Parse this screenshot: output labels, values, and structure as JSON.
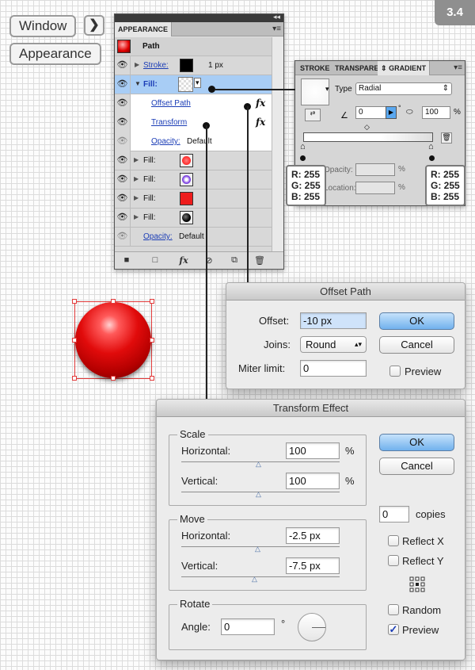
{
  "step_badge": "3.4",
  "menu_path": {
    "window_label": "Window",
    "arrow_icon": "chevron-right-icon",
    "appearance_label": "Appearance"
  },
  "appearance_panel": {
    "tab": "APPEARANCE",
    "object_label": "Path",
    "rows": [
      {
        "label": "Stroke:",
        "value": "1 px",
        "swatch": "#000000"
      },
      {
        "label": "Fill:"
      },
      {
        "label": "Offset Path",
        "fx": "fx"
      },
      {
        "label": "Transform",
        "fx": "fx"
      },
      {
        "label": "Opacity:",
        "value": "Default"
      },
      {
        "label": "Fill:",
        "swatch": "#ff1a1a"
      },
      {
        "label": "Fill:",
        "swatch": "#7b3fe0"
      },
      {
        "label": "Fill:",
        "swatch": "#ee1c1c"
      },
      {
        "label": "Fill:",
        "swatch": "#000000"
      },
      {
        "label": "Opacity:",
        "value": "Default"
      }
    ],
    "bottom_fx": "fx"
  },
  "gradient_panel": {
    "tabs": [
      "STROKE",
      "TRANSPARE",
      "GRADIENT"
    ],
    "type_label": "Type",
    "type_value": "Radial",
    "angle_value": "0",
    "angle_unit": "°",
    "aspect_value": "100",
    "aspect_unit": "%",
    "opacity_label": "Opacity:",
    "location_label": "Location:",
    "percent": "%"
  },
  "rgb_left": {
    "r": "R: 255",
    "g": "G: 255",
    "b": "B: 255"
  },
  "rgb_right": {
    "r": "R: 255",
    "g": "G: 255",
    "b": "B: 255"
  },
  "offset_path": {
    "title": "Offset Path",
    "offset_label": "Offset:",
    "offset_value": "-10 px",
    "joins_label": "Joins:",
    "joins_value": "Round",
    "miter_label": "Miter limit:",
    "miter_value": "0",
    "ok": "OK",
    "cancel": "Cancel",
    "preview": "Preview"
  },
  "transform_effect": {
    "title": "Transform Effect",
    "scale_title": "Scale",
    "scale_h_label": "Horizontal:",
    "scale_h_value": "100",
    "scale_v_label": "Vertical:",
    "scale_v_value": "100",
    "percent": "%",
    "move_title": "Move",
    "move_h_label": "Horizontal:",
    "move_h_value": "-2.5 px",
    "move_v_label": "Vertical:",
    "move_v_value": "-7.5 px",
    "rotate_title": "Rotate",
    "angle_label": "Angle:",
    "angle_value": "0",
    "degree": "°",
    "ok": "OK",
    "cancel": "Cancel",
    "copies_value": "0",
    "copies_label": "copies",
    "reflect_x": "Reflect X",
    "reflect_y": "Reflect Y",
    "random": "Random",
    "preview": "Preview",
    "preview_checked": true
  },
  "colors": {
    "accent_blue": "#71b1ed",
    "ball_red": "#e10b0b",
    "selection": "#e23a3a"
  }
}
